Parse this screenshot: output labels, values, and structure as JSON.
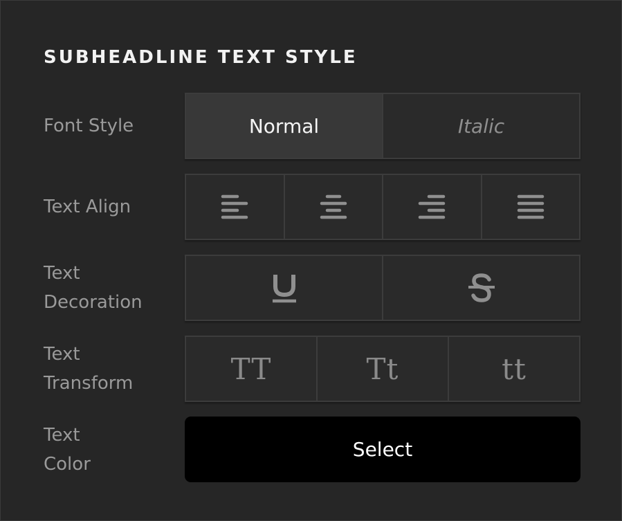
{
  "panel": {
    "title": "SUBHEADLINE TEXT STYLE"
  },
  "font_style": {
    "label": "Font Style",
    "options": [
      "Normal",
      "Italic"
    ],
    "selected": "Normal"
  },
  "text_align": {
    "label": "Text Align",
    "options": [
      "align-left-icon",
      "align-center-icon",
      "align-right-icon",
      "align-justify-icon"
    ]
  },
  "text_decoration": {
    "label_line1": "Text",
    "label_line2": "Decoration",
    "options": [
      "underline-icon",
      "strikethrough-icon"
    ]
  },
  "text_transform": {
    "label_line1": "Text",
    "label_line2": "Transform",
    "options": [
      "TT",
      "Tt",
      "tt"
    ]
  },
  "text_color": {
    "label_line1": "Text",
    "label_line2": "Color",
    "button_label": "Select"
  },
  "colors": {
    "background": "#262626",
    "segment_bg": "#2a2a2a",
    "segment_active": "#383838",
    "border": "#3c3c3c",
    "label": "#9a9a9a",
    "icon": "#8c8c8c",
    "select_bg": "#000000"
  }
}
